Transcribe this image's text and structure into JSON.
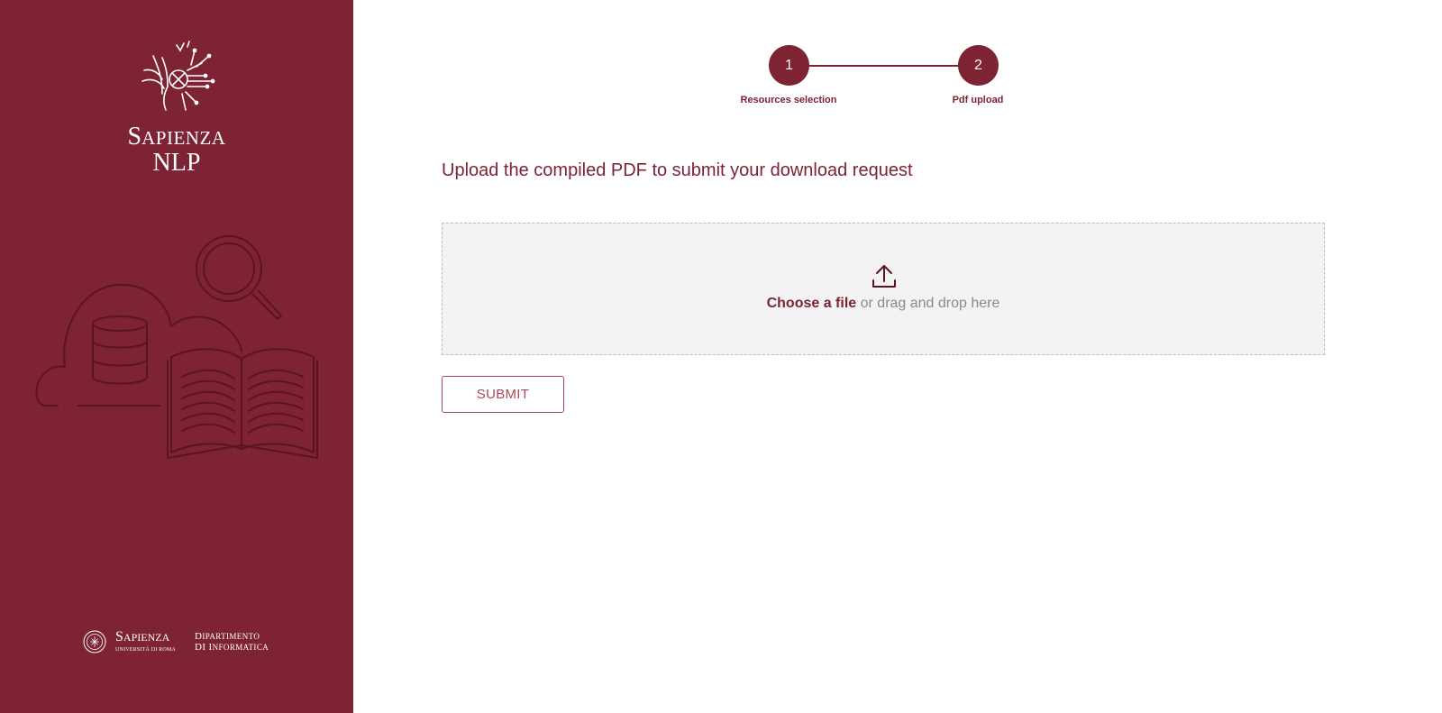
{
  "brand": {
    "logo_line1_initial": "S",
    "logo_line1_rest": "APIENZA",
    "logo_line2": "NLP",
    "footer_sapienza_initial": "S",
    "footer_sapienza_rest": "APIENZA",
    "footer_sapienza_sub": "UNIVERSITÀ DI ROMA",
    "footer_dip_line1_initial": "D",
    "footer_dip_line1_rest": "IPARTIMENTO",
    "footer_dip_line2_initial": "DI I",
    "footer_dip_line2_rest": "NFORMATICA",
    "color": "#7d2333"
  },
  "stepper": {
    "steps": [
      {
        "number": "1",
        "label": "Resources selection"
      },
      {
        "number": "2",
        "label": "Pdf upload"
      }
    ],
    "active_step": 2
  },
  "main": {
    "heading": "Upload the compiled PDF to submit your download request",
    "dropzone": {
      "icon": "upload-icon",
      "choose_label": "Choose a file",
      "rest_label": " or drag and drop here"
    },
    "submit_label": "SUBMIT"
  },
  "icons": {
    "sidebar_logo": "sapienza-nlp-logo-icon",
    "illustration": "cloud-database-book-search-illustration",
    "footer_seal": "sapienza-seal-icon"
  }
}
